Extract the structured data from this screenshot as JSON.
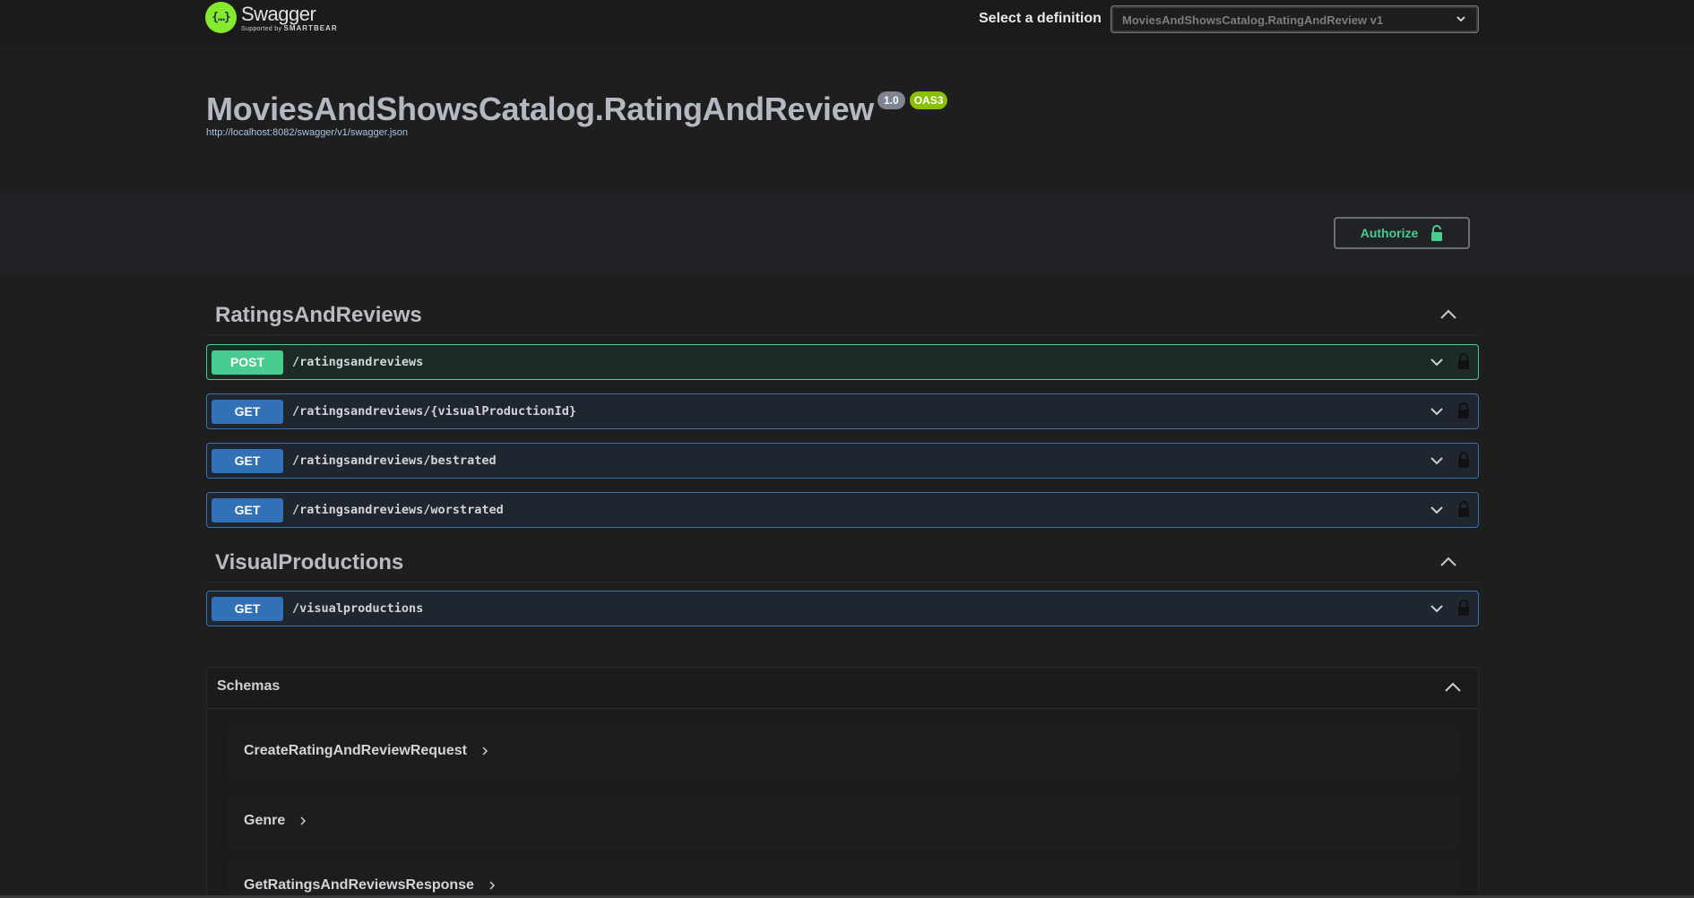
{
  "topbar": {
    "logo_name": "Swagger",
    "logo_sub_prefix": "Supported by",
    "logo_sub_brand": "SMARTBEAR",
    "logo_glyph": "{…}",
    "definition_label": "Select a definition",
    "definition_value": "MoviesAndShowsCatalog.RatingAndReview v1"
  },
  "info": {
    "title": "MoviesAndShowsCatalog.RatingAndReview",
    "version": "1.0",
    "oas": "OAS3",
    "spec_url": "http://localhost:8082/swagger/v1/swagger.json"
  },
  "auth": {
    "label": "Authorize"
  },
  "tags": [
    {
      "name": "RatingsAndReviews",
      "operations": [
        {
          "method": "POST",
          "path": "/ratingsandreviews"
        },
        {
          "method": "GET",
          "path": "/ratingsandreviews/{visualProductionId}"
        },
        {
          "method": "GET",
          "path": "/ratingsandreviews/bestrated"
        },
        {
          "method": "GET",
          "path": "/ratingsandreviews/worstrated"
        }
      ]
    },
    {
      "name": "VisualProductions",
      "operations": [
        {
          "method": "GET",
          "path": "/visualproductions"
        }
      ]
    }
  ],
  "schemas": {
    "title": "Schemas",
    "models": [
      "CreateRatingAndReviewRequest",
      "Genre",
      "GetRatingsAndReviewsResponse"
    ]
  },
  "colors": {
    "post": "#49cc90",
    "get": "#3270b7",
    "oas": "#89bf04",
    "logo": "#85ea2d"
  }
}
